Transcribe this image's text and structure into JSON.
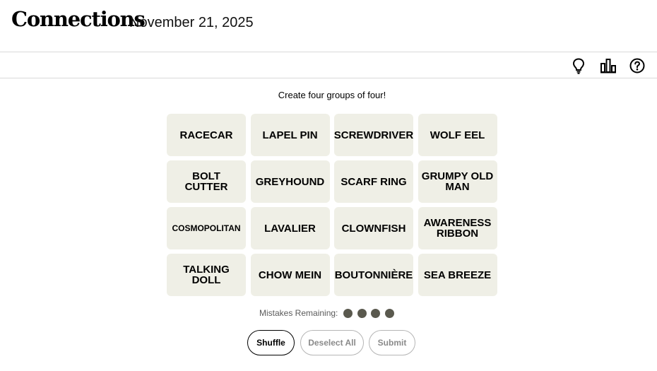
{
  "header": {
    "title": "Connections",
    "date": "November 21, 2025"
  },
  "toolbar": {
    "icons": [
      "hint-bulb-icon",
      "stats-bar-chart-icon",
      "help-question-icon"
    ]
  },
  "instruction": "Create four groups of four!",
  "tiles": [
    "RACECAR",
    "LAPEL PIN",
    "SCREWDRIVER",
    "WOLF EEL",
    "BOLT CUTTER",
    "GREYHOUND",
    "SCARF RING",
    "GRUMPY OLD MAN",
    "COSMOPOLITAN",
    "LAVALIER",
    "CLOWNFISH",
    "AWARENESS RIBBON",
    "TALKING DOLL",
    "CHOW MEIN",
    "BOUTONNIÈRE",
    "SEA BREEZE"
  ],
  "mistakes": {
    "label": "Mistakes Remaining:",
    "remaining": 4
  },
  "buttons": {
    "shuffle": "Shuffle",
    "deselect_all": "Deselect All",
    "submit": "Submit"
  },
  "colors": {
    "tile_bg": "#efefe6",
    "dot": "#5a594e"
  }
}
